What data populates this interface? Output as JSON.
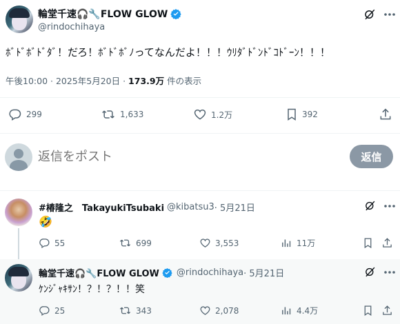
{
  "post": {
    "display_name": "輪堂千速🎧🔧FLOW GLOW",
    "handle": "@rindochihaya",
    "text": "ﾎﾞﾄﾞﾎﾞﾄﾞﾀﾞ！だろ！ﾎﾞﾄﾞﾎﾞﾉってなんだよ！！！ｳﾘﾀﾞﾄﾞﾝﾄﾞｺﾄﾞｰﾝ！！！",
    "time": "午後10:00 · 2025年5月20日 · ",
    "views_count": "173.9万",
    "views_label": " 件の表示",
    "replies": "299",
    "reposts": "1,633",
    "likes": "1.2万",
    "bookmarks": "392"
  },
  "composer": {
    "placeholder": "返信をポスト",
    "button_label": "返信"
  },
  "replies": [
    {
      "display_name": "#椿隆之　TakayukiTsubaki",
      "handle": "@kibatsu3",
      "date": " · 5月21日",
      "text": "🤣",
      "replies": "55",
      "reposts": "699",
      "likes": "3,553",
      "views": "11万"
    },
    {
      "display_name": "輪堂千速🎧🔧FLOW GLOW",
      "handle": "@rindochihaya",
      "date": " · 5月21日",
      "text": "ｹﾝｼﾞｬｷｻﾝ！？！？！！笑",
      "replies": "25",
      "reposts": "343",
      "likes": "2,078",
      "views": "4.4万"
    }
  ],
  "colors": {
    "verified": "#1d9bf0",
    "muted": "#536471",
    "highlight_bg": "#f7f9f9"
  }
}
